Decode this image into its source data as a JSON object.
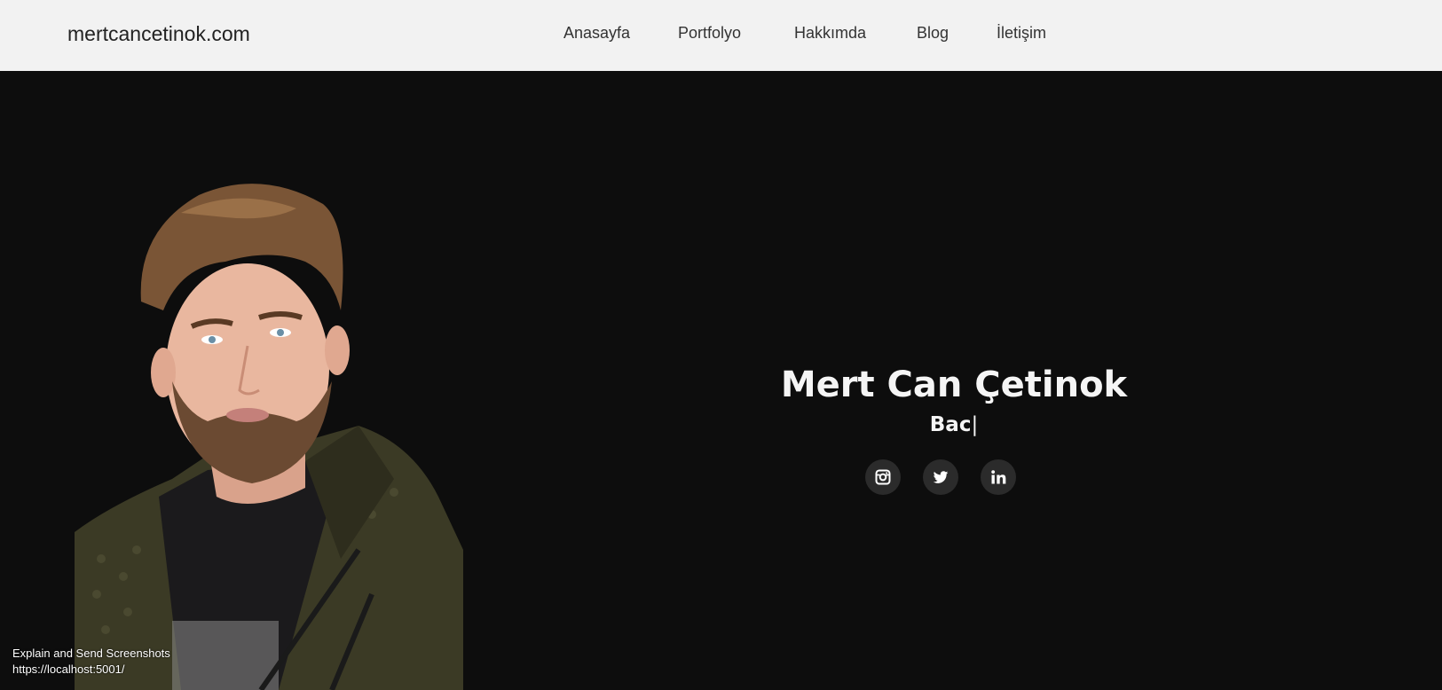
{
  "navbar": {
    "brand": "mertcancetinok.com",
    "links": [
      {
        "label": "Anasayfa"
      },
      {
        "label": "Portfolyo"
      },
      {
        "label": "Hakkımda"
      },
      {
        "label": "Blog"
      },
      {
        "label": "İletişim"
      }
    ]
  },
  "hero": {
    "name": "Mert Can Çetinok",
    "typed_text": "Bac",
    "cursor": "|",
    "social": [
      {
        "icon": "instagram-icon"
      },
      {
        "icon": "twitter-icon"
      },
      {
        "icon": "linkedin-icon"
      }
    ]
  },
  "overlay": {
    "line1": "Explain and Send Screenshots",
    "line2": "https://localhost:5001/"
  },
  "colors": {
    "navbar_bg": "#f2f2f2",
    "page_bg": "#0d0d0d",
    "social_btn_bg": "#2b2b2b"
  }
}
